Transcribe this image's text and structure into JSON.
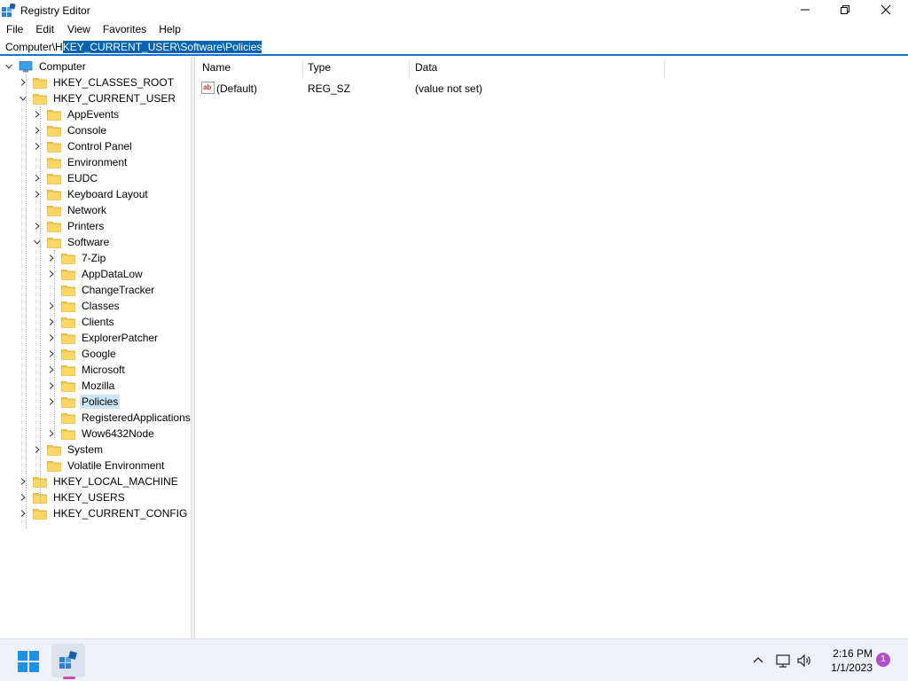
{
  "window": {
    "title": "Registry Editor",
    "icons": [
      "registry-editor-icon",
      "minimize-icon",
      "maximize-icon",
      "close-icon"
    ]
  },
  "menu": {
    "file": "File",
    "edit": "Edit",
    "view": "View",
    "favorites": "Favorites",
    "help": "Help"
  },
  "address": {
    "prefix": "Computer\\H",
    "selected": "KEY_CURRENT_USER\\Software\\Policies"
  },
  "tree": {
    "computer": "Computer",
    "hkcr": "HKEY_CLASSES_ROOT",
    "hkcu": "HKEY_CURRENT_USER",
    "hkcu_children": [
      "AppEvents",
      "Console",
      "Control Panel",
      "Environment",
      "EUDC",
      "Keyboard Layout",
      "Network",
      "Printers",
      "Software"
    ],
    "software_children": [
      "7-Zip",
      "AppDataLow",
      "ChangeTracker",
      "Classes",
      "Clients",
      "ExplorerPatcher",
      "Google",
      "Microsoft",
      "Mozilla",
      "Policies",
      "RegisteredApplications",
      "Wow6432Node"
    ],
    "hkcu_after": [
      "System",
      "Volatile Environment"
    ],
    "hklm": "HKEY_LOCAL_MACHINE",
    "hku": "HKEY_USERS",
    "hkcc": "HKEY_CURRENT_CONFIG",
    "selected_key": "Policies"
  },
  "list": {
    "columns": [
      "Name",
      "Type",
      "Data"
    ],
    "rows": [
      {
        "name": "(Default)",
        "type": "REG_SZ",
        "data": "(value not set)"
      }
    ]
  },
  "taskbar": {
    "time": "2:16 PM",
    "date": "1/1/2023",
    "notification_count": "1",
    "icons": [
      "windows-start-icon",
      "registry-editor-task-icon",
      "chevron-up-icon",
      "network-icon",
      "volume-icon"
    ]
  }
}
